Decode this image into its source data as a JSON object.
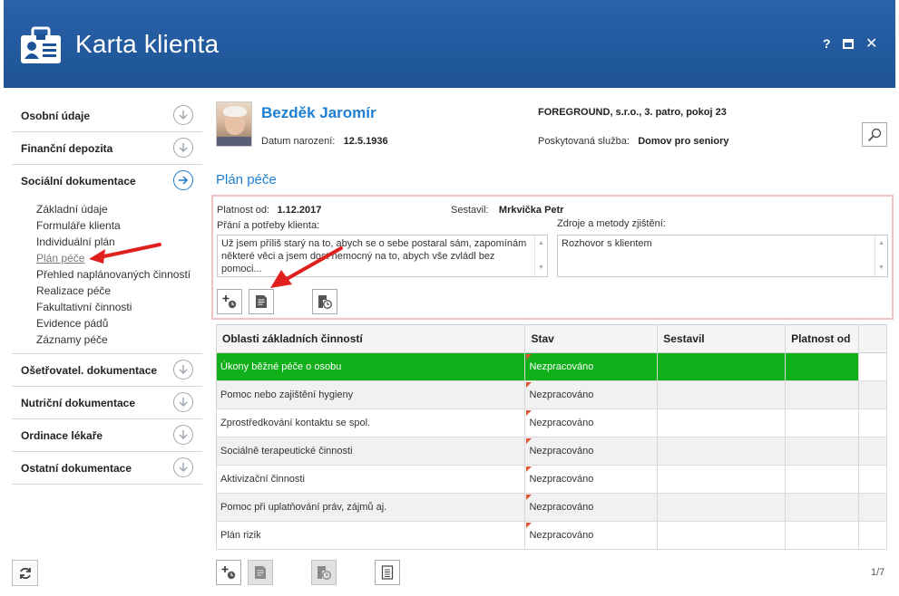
{
  "window": {
    "title": "Karta klienta",
    "controls": {
      "help": "?",
      "close": "✕"
    }
  },
  "sidebar": {
    "sections": [
      {
        "label": "Osobní údaje",
        "expanded": false
      },
      {
        "label": "Finanční depozita",
        "expanded": false
      },
      {
        "label": "Sociální dokumentace",
        "expanded": true,
        "items": [
          "Základní údaje",
          "Formuláře klienta",
          "Individuální plán",
          "Plán péče",
          "Přehled naplánovaných činností",
          "Realizace péče",
          "Fakultativní činnosti",
          "Evidence pádů",
          "Záznamy péče"
        ],
        "current_item": "Plán péče"
      },
      {
        "label": "Ošetřovatel. dokumentace",
        "expanded": false
      },
      {
        "label": "Nutriční dokumentace",
        "expanded": false
      },
      {
        "label": "Ordinace lékaře",
        "expanded": false
      },
      {
        "label": "Ostatní dokumentace",
        "expanded": false
      }
    ]
  },
  "client": {
    "name": "Bezděk Jaromír",
    "dob_label": "Datum narození:",
    "dob": "12.5.1936",
    "address": "FOREGROUND, s.r.o., 3. patro, pokoj 23",
    "service_label": "Poskytovaná služba:",
    "service": "Domov pro seniory"
  },
  "plan": {
    "title": "Plán péče",
    "platnost_label": "Platnost od:",
    "platnost": "1.12.2017",
    "sestavil_label": "Sestavil:",
    "sestavil": "Mrkvička Petr",
    "prani_label": "Přání a potřeby klienta:",
    "prani_text": "Už jsem příliš starý na to, abych se o sebe postaral sám, zapomínám některé věci a jsem dost nemocný na to, abych vše zvládl bez pomoci...",
    "zdroje_label": "Zdroje a metody zjištění:",
    "zdroje_text": "Rozhovor s klientem"
  },
  "table": {
    "columns": [
      "Oblasti základních činností",
      "Stav",
      "Sestavil",
      "Platnost od"
    ],
    "rows": [
      {
        "oblast": "Úkony běžné péče o osobu",
        "stav": "Nezpracováno",
        "sestavil": "",
        "platnost": ""
      },
      {
        "oblast": "Pomoc nebo zajištění hygieny",
        "stav": "Nezpracováno",
        "sestavil": "",
        "platnost": ""
      },
      {
        "oblast": "Zprostředkování kontaktu se spol.",
        "stav": "Nezpracováno",
        "sestavil": "",
        "platnost": ""
      },
      {
        "oblast": "Sociálně terapeutické činnosti",
        "stav": "Nezpracováno",
        "sestavil": "",
        "platnost": ""
      },
      {
        "oblast": "Aktivizační činnosti",
        "stav": "Nezpracováno",
        "sestavil": "",
        "platnost": ""
      },
      {
        "oblast": "Pomoc při uplatňování práv, zájmů aj.",
        "stav": "Nezpracováno",
        "sestavil": "",
        "platnost": ""
      },
      {
        "oblast": "Plán rizik",
        "stav": "Nezpracováno",
        "sestavil": "",
        "platnost": ""
      }
    ],
    "selected_row": 0
  },
  "pager": "1/7",
  "colors": {
    "titlebar": "#1d5396",
    "accent": "#1d7fd2",
    "selected_row": "#10b01a",
    "annotation_arrow": "#e0201e"
  }
}
